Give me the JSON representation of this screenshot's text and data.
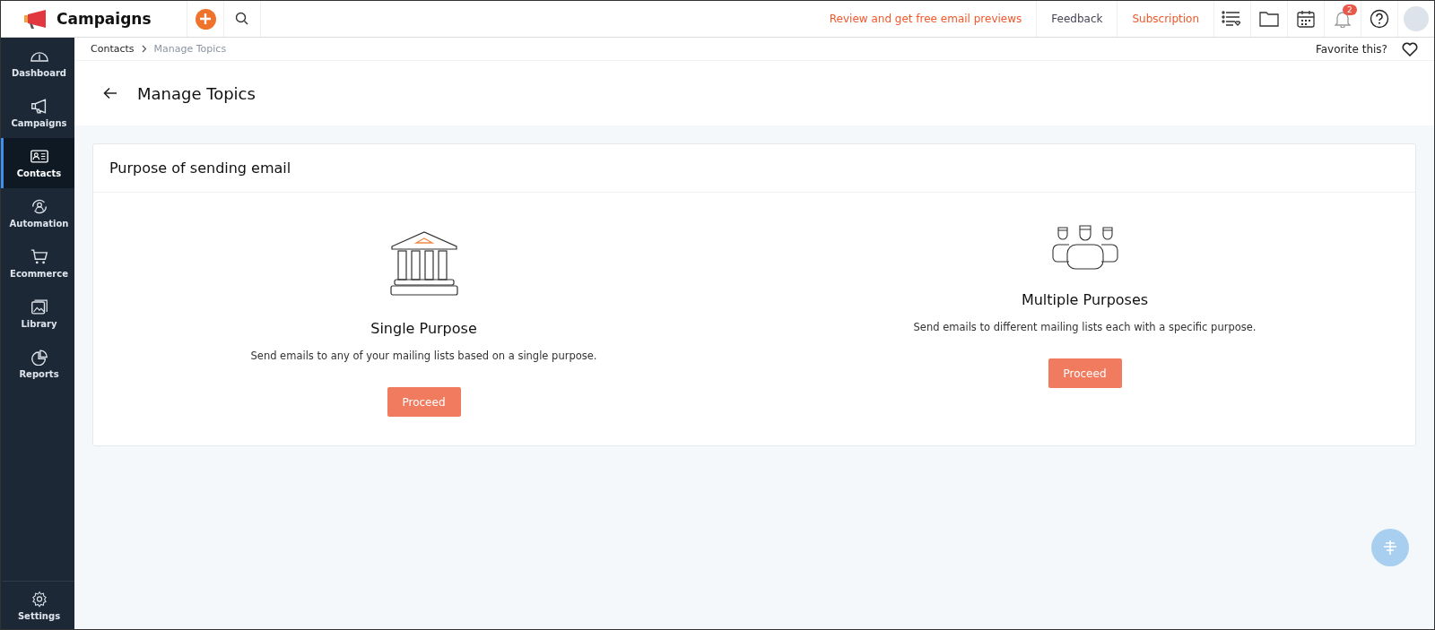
{
  "app": {
    "title": "Campaigns"
  },
  "header_links": [
    {
      "label": "Review and get free email previews",
      "kind": "promo"
    },
    {
      "label": "Feedback",
      "kind": "plain"
    },
    {
      "label": "Subscription",
      "kind": "promo"
    }
  ],
  "notifications": {
    "count": "2"
  },
  "sidebar": {
    "items": [
      {
        "label": "Dashboard",
        "kind": "dashboard",
        "selected": false
      },
      {
        "label": "Campaigns",
        "kind": "campaigns",
        "selected": false
      },
      {
        "label": "Contacts",
        "kind": "contacts",
        "selected": true
      },
      {
        "label": "Automation",
        "kind": "automation",
        "selected": false
      },
      {
        "label": "Ecommerce",
        "kind": "ecommerce",
        "selected": false
      },
      {
        "label": "Library",
        "kind": "library",
        "selected": false
      },
      {
        "label": "Reports",
        "kind": "reports",
        "selected": false
      }
    ],
    "footer": {
      "label": "Settings"
    }
  },
  "breadcrumb": {
    "parent": "Contacts",
    "current": "Manage Topics"
  },
  "favorite": {
    "label": "Favorite this?"
  },
  "page": {
    "title": "Manage Topics"
  },
  "panel": {
    "title": "Purpose of sending email",
    "options": [
      {
        "kind": "single",
        "title": "Single Purpose",
        "description": "Send emails to any of your mailing lists based on a single purpose.",
        "button": "Proceed"
      },
      {
        "kind": "multiple",
        "title": "Multiple Purposes",
        "description": "Send emails to different mailing lists each with a specific purpose.",
        "button": "Proceed"
      }
    ]
  }
}
